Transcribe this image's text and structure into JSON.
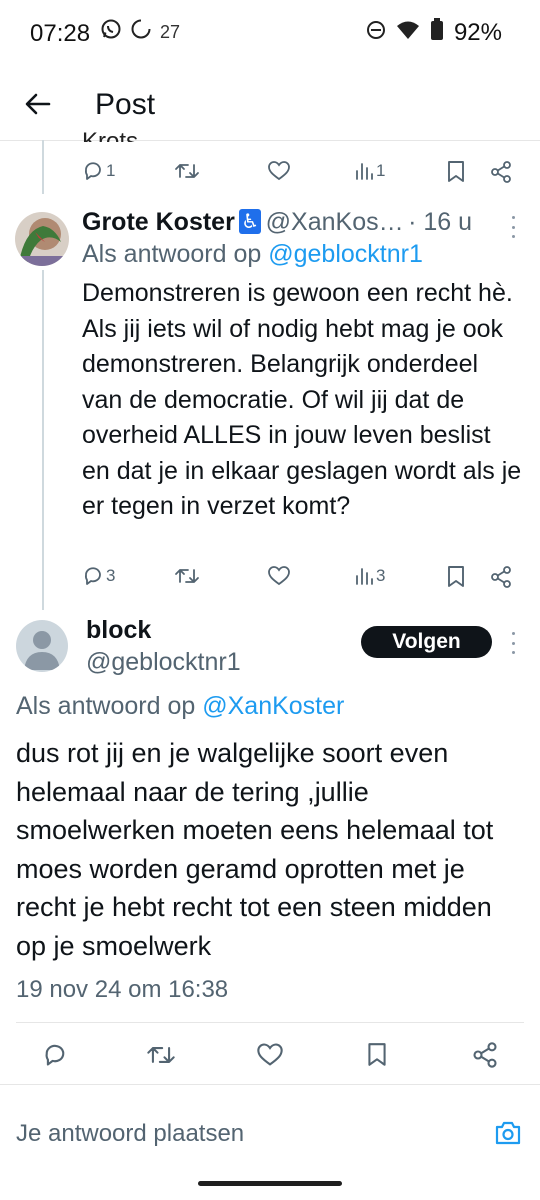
{
  "status_bar": {
    "time": "07:28",
    "notif_count": "27",
    "battery": "92%"
  },
  "header": {
    "title": "Post"
  },
  "parent_tweet_actions": {
    "replies": "1",
    "views": "1"
  },
  "reply_tweet": {
    "name": "Grote Koster",
    "badge": "♿",
    "handle": "@XanKos…",
    "time": "· 16 u",
    "reply_prefix": "Als antwoord op",
    "reply_to": "@geblocktnr1",
    "text": "Demonstreren is gewoon een recht hè. Als jij iets wil of nodig hebt mag je ook demonstreren. Belangrijk onderdeel van de democratie. Of wil jij dat de overheid ALLES in jouw leven beslist en dat je in elkaar geslagen wordt als je er tegen in verzet komt?",
    "replies": "3",
    "views": "3"
  },
  "main_tweet": {
    "name": "block",
    "handle": "@geblocktnr1",
    "follow_label": "Volgen",
    "reply_prefix": "Als antwoord op",
    "reply_to": "@XanKoster",
    "text": "dus rot jij en je walgelijke soort even helemaal naar de tering ,jullie smoelwerken moeten eens helemaal tot moes worden geramd  oprotten met je recht je hebt recht tot een steen midden op je smoelwerk",
    "timestamp": "19 nov 24 om 16:38"
  },
  "compose": {
    "placeholder": "Je antwoord plaatsen"
  },
  "colors": {
    "link": "#1d9bf0",
    "secondary_text": "#536471",
    "follow_button": "#0f1419"
  }
}
